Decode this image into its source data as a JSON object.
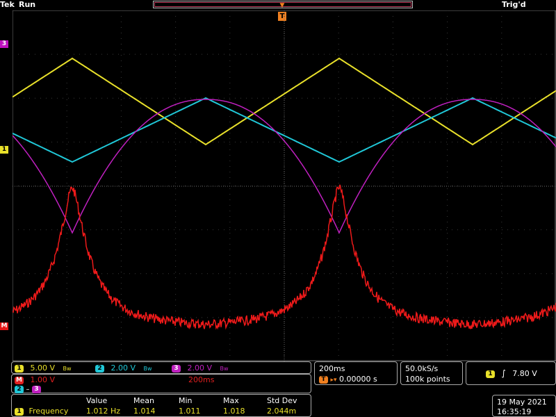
{
  "header": {
    "brand": "Tek",
    "status": "Run",
    "trigger_state": "Trig'd"
  },
  "colors": {
    "ch1": "#e8e02a",
    "ch2": "#20c8d8",
    "ch3": "#c020c0",
    "math": "#ee1a1a",
    "trigger": "#f08020"
  },
  "markers": {
    "ch3": "3",
    "ch1": "1",
    "math": "M",
    "trigger": "T"
  },
  "channels": [
    {
      "num": "1",
      "scale": "5.00 V",
      "bw": "Bw"
    },
    {
      "num": "2",
      "scale": "2.00 V",
      "bw": "Bw"
    },
    {
      "num": "3",
      "scale": "2.00 V",
      "bw": "Bw"
    }
  ],
  "math": {
    "label": "M",
    "scale": "1.00 V",
    "time": "200ms",
    "sources": [
      "2",
      "3"
    ]
  },
  "horizontal": {
    "scale": "200ms",
    "position": "0.00000 s"
  },
  "acquisition": {
    "rate": "50.0kS/s",
    "points": "100k points"
  },
  "trigger": {
    "channel": "1",
    "level": "7.80 V",
    "slope_icon": "rising-edge-icon"
  },
  "measurement": {
    "channel": "1",
    "name": "Frequency",
    "headers": [
      "Value",
      "Mean",
      "Min",
      "Max",
      "Std Dev"
    ],
    "values": [
      "1.012 Hz",
      "1.014",
      "1.011",
      "1.018",
      "2.044m"
    ]
  },
  "datetime": {
    "date": "19 May 2021",
    "time": "16:35:19"
  }
}
